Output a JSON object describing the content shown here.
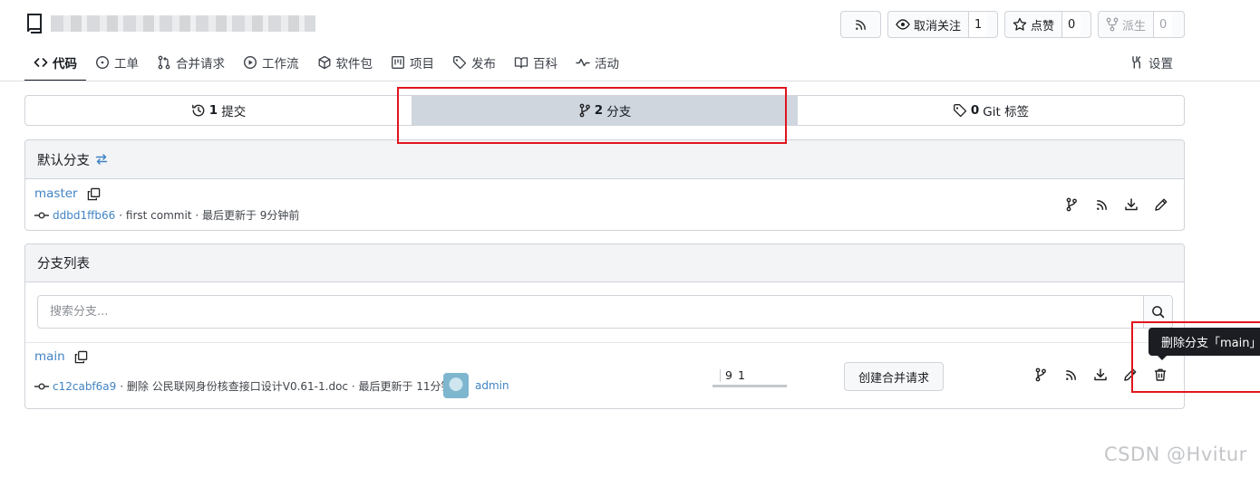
{
  "header": {
    "watch_label": "取消关注",
    "watch_count": "1",
    "star_label": "点赞",
    "star_count": "0",
    "fork_label": "派生",
    "fork_count": "0"
  },
  "nav": {
    "tabs": [
      {
        "label": "代码",
        "icon": "code-icon"
      },
      {
        "label": "工单",
        "icon": "issue-icon"
      },
      {
        "label": "合并请求",
        "icon": "pull-request-icon"
      },
      {
        "label": "工作流",
        "icon": "play-icon"
      },
      {
        "label": "软件包",
        "icon": "package-icon"
      },
      {
        "label": "项目",
        "icon": "project-icon"
      },
      {
        "label": "发布",
        "icon": "tag-icon"
      },
      {
        "label": "百科",
        "icon": "book-icon"
      },
      {
        "label": "活动",
        "icon": "pulse-icon"
      }
    ],
    "settings_label": "设置"
  },
  "stats": {
    "commits_count": "1",
    "commits_label": "提交",
    "branches_count": "2",
    "branches_label": "分支",
    "tags_count": "0",
    "tags_label": "Git 标签"
  },
  "default_branch": {
    "heading": "默认分支",
    "name": "master",
    "commit_sha": "ddbd1ffb66",
    "commit_msg": "· first commit · 最后更新于 9分钟前"
  },
  "branch_list": {
    "heading": "分支列表",
    "search_placeholder": "搜索分支...",
    "branches": [
      {
        "name": "main",
        "commit_sha": "c12cabf6a9",
        "commit_msg": "· 删除 公民联网身份核查接口设计V0.61-1.doc · 最后更新于 11分钟前",
        "author": "admin",
        "ahead": "1",
        "behind": "9",
        "create_pr_label": "创建合并请求"
      }
    ]
  },
  "tooltip": {
    "text": "删除分支「main」"
  },
  "watermark": "CSDN @Hvitur",
  "colors": {
    "link": "#4183c4",
    "active_stat": "#d0d6de",
    "highlight": "#e0151d",
    "tooltip_bg": "#1b1d22"
  }
}
